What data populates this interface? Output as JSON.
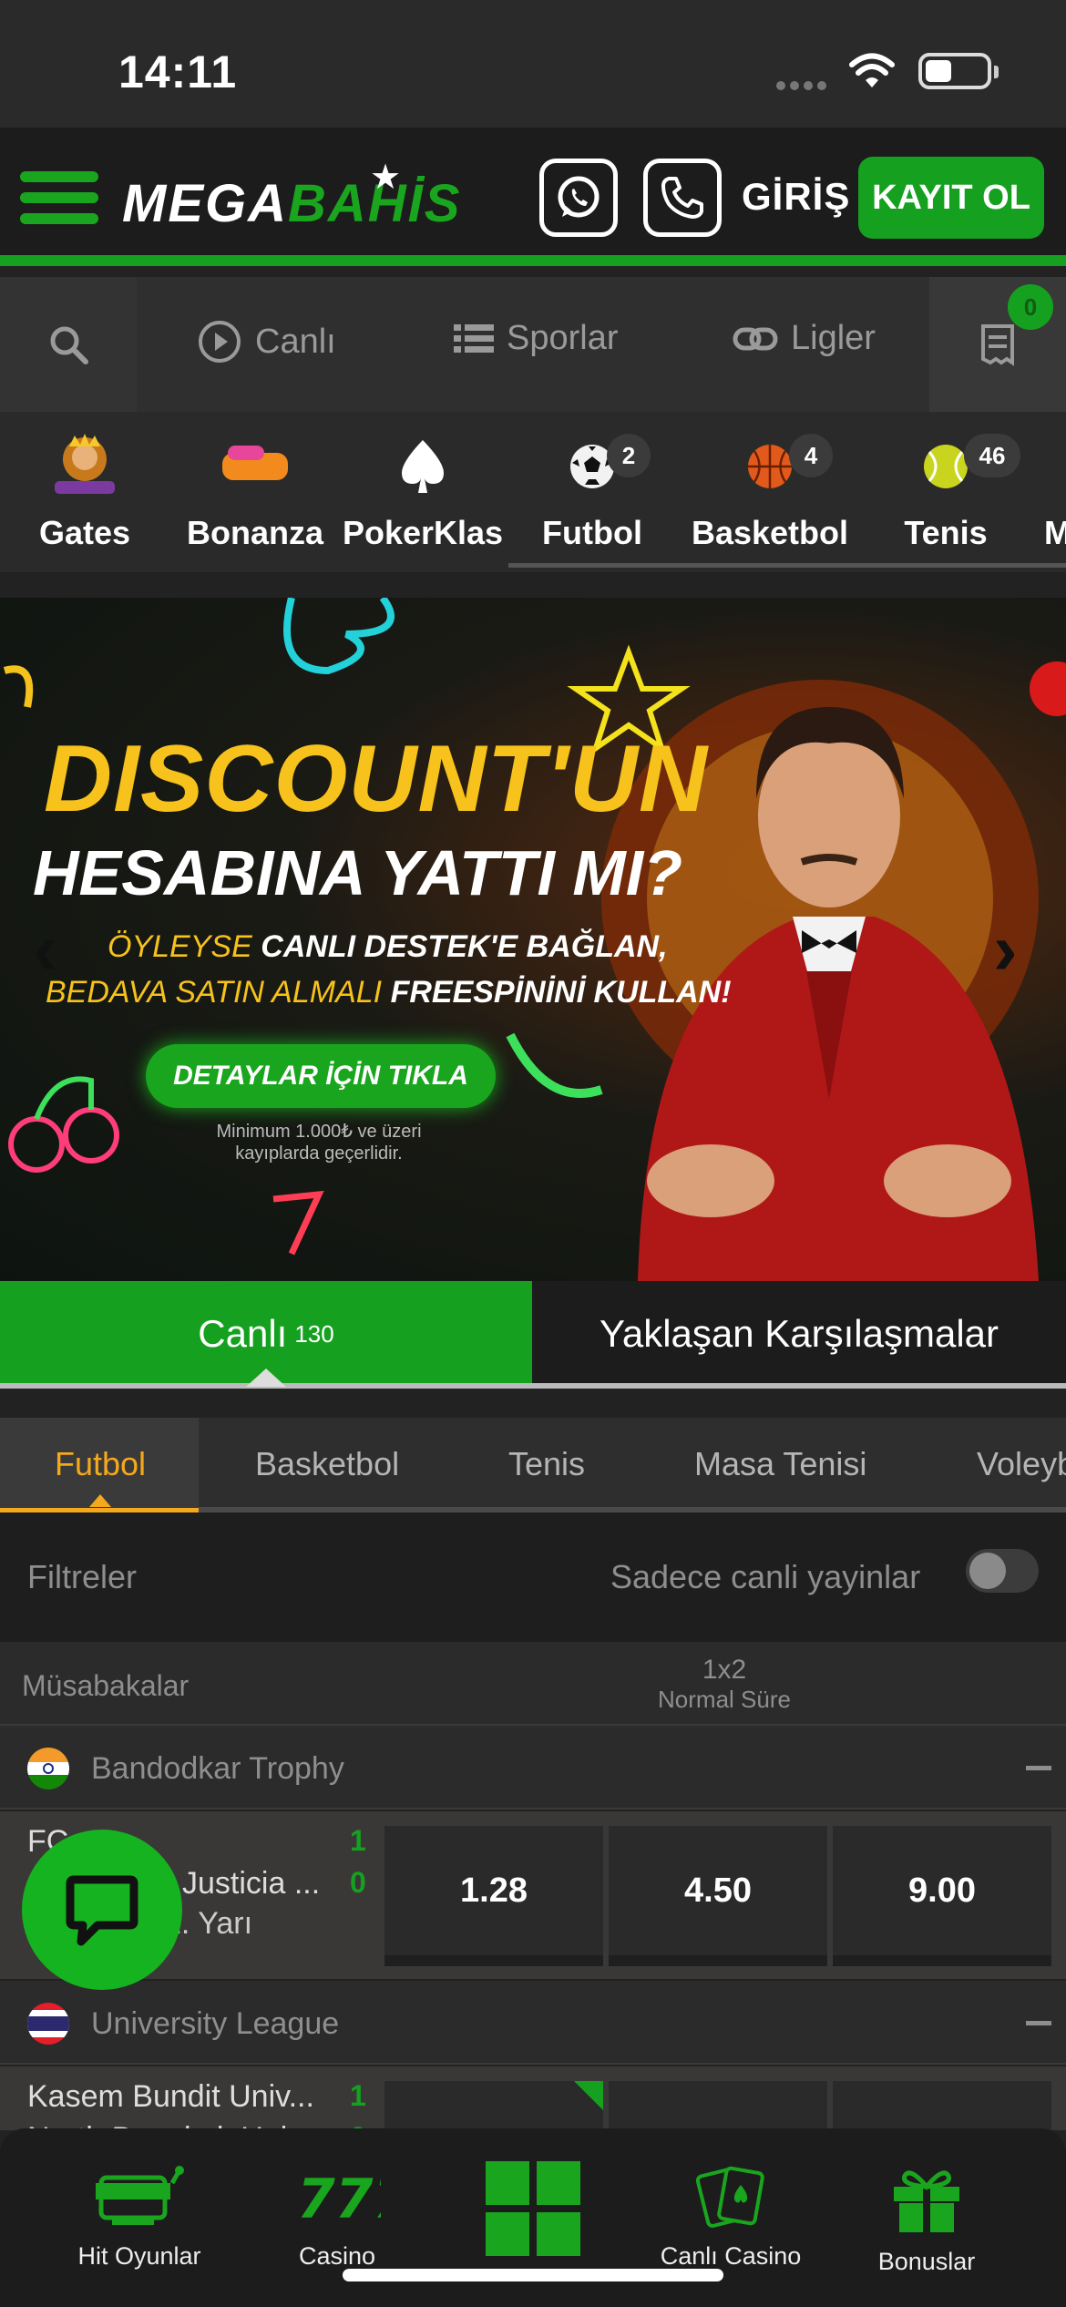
{
  "status": {
    "time": "14:11"
  },
  "header": {
    "logo_part1": "MEGA",
    "logo_part2": "BAHİS",
    "login": "GİRİŞ",
    "register": "KAYIT OL"
  },
  "secnav": {
    "live": "Canlı",
    "sports": "Sporlar",
    "leagues": "Ligler",
    "betslip_count": "0"
  },
  "quick": [
    {
      "label": "Gates",
      "badge": ""
    },
    {
      "label": "Bonanza",
      "badge": ""
    },
    {
      "label": "PokerKlas",
      "badge": ""
    },
    {
      "label": "Futbol",
      "badge": "2"
    },
    {
      "label": "Basketbol",
      "badge": "4"
    },
    {
      "label": "Tenis",
      "badge": "46"
    },
    {
      "label": "M",
      "badge": ""
    }
  ],
  "banner": {
    "headline1": "DISCOUNT'UN",
    "headline2": "HESABINA YATTI MI?",
    "line1_a": "ÖYLEYSE ",
    "line1_b": "CANLI DESTEK'E BAĞLAN,",
    "line2_a": "BEDAVA SATIN ALMALI ",
    "line2_b": "FREESPİNİNİ KULLAN!",
    "button": "DETAYLAR İÇİN TIKLA",
    "note": "Minimum 1.000₺ ve üzeri kayıplarda geçerlidir.",
    "prev": "‹",
    "next": "›"
  },
  "live_tabs": {
    "live": "Canlı",
    "live_count": "130",
    "upcoming": "Yaklaşan Karşılaşmalar"
  },
  "sport_tabs": [
    "Futbol",
    "Basketbol",
    "Tenis",
    "Masa Tenisi",
    "Voleyb"
  ],
  "filters": {
    "label": "Filtreler",
    "stream_only": "Sadece canli yayinlar"
  },
  "table_header": {
    "competitions": "Müsabakalar",
    "market": "1x2",
    "period": "Normal Süre"
  },
  "leagues": [
    {
      "name": "Bandodkar Trophy",
      "match": {
        "team1": "FC",
        "team2": "Justicia ...",
        "score1": "1",
        "score2": "0",
        "time": "1. Yarı",
        "odds": [
          "1.28",
          "4.50",
          "9.00"
        ]
      }
    },
    {
      "name": "University League",
      "match": {
        "team1": "Kasem Bundit Univ...",
        "team2": "North Bangkok Uni...",
        "score1": "1",
        "score2": "0"
      }
    }
  ],
  "bottom_nav": [
    "Hit Oyunlar",
    "Casino",
    "",
    "Canlı Casino",
    "Bonuslar"
  ]
}
